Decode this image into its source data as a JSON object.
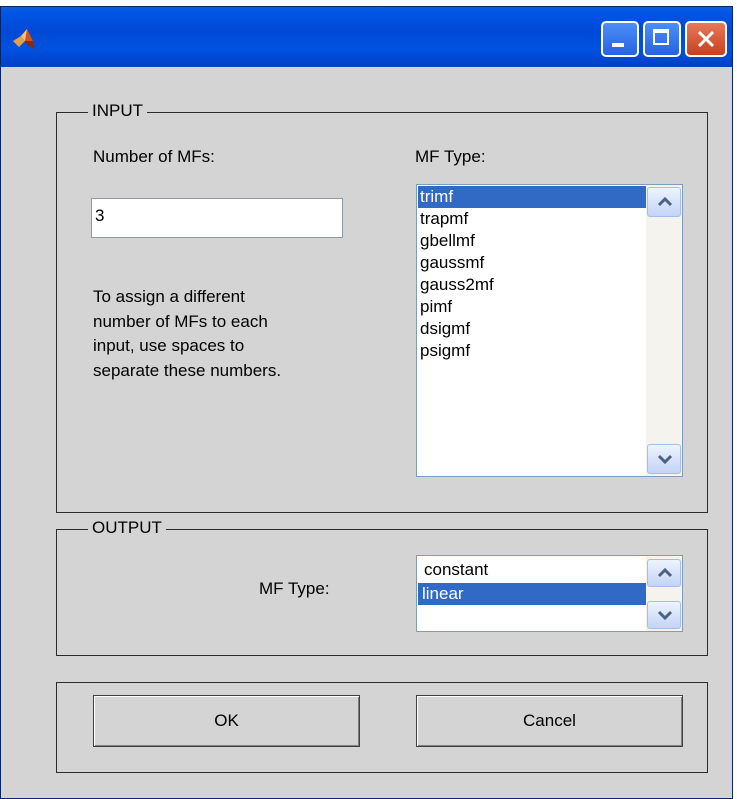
{
  "titlebar": {
    "title": ""
  },
  "input": {
    "legend": "INPUT",
    "num_mfs_label": "Number of MFs:",
    "num_mfs_value": "3",
    "hint_lines": [
      "To assign a different",
      "number of MFs to each",
      "input, use spaces to",
      "separate these numbers."
    ],
    "mf_type_label": "MF Type:",
    "mf_types": [
      "trimf",
      "trapmf",
      "gbellmf",
      "gaussmf",
      "gauss2mf",
      "pimf",
      "dsigmf",
      "psigmf"
    ],
    "selected_mf_type": "trimf"
  },
  "output": {
    "legend": "OUTPUT",
    "mf_type_label": "MF Type:",
    "mf_types": [
      "constant",
      "linear"
    ],
    "selected_mf_type": "linear"
  },
  "buttons": {
    "ok": "OK",
    "cancel": "Cancel"
  },
  "colors": {
    "titlebar": "#0055e5",
    "selection": "#316ac5",
    "dialog_bg": "#d4d4d4"
  }
}
